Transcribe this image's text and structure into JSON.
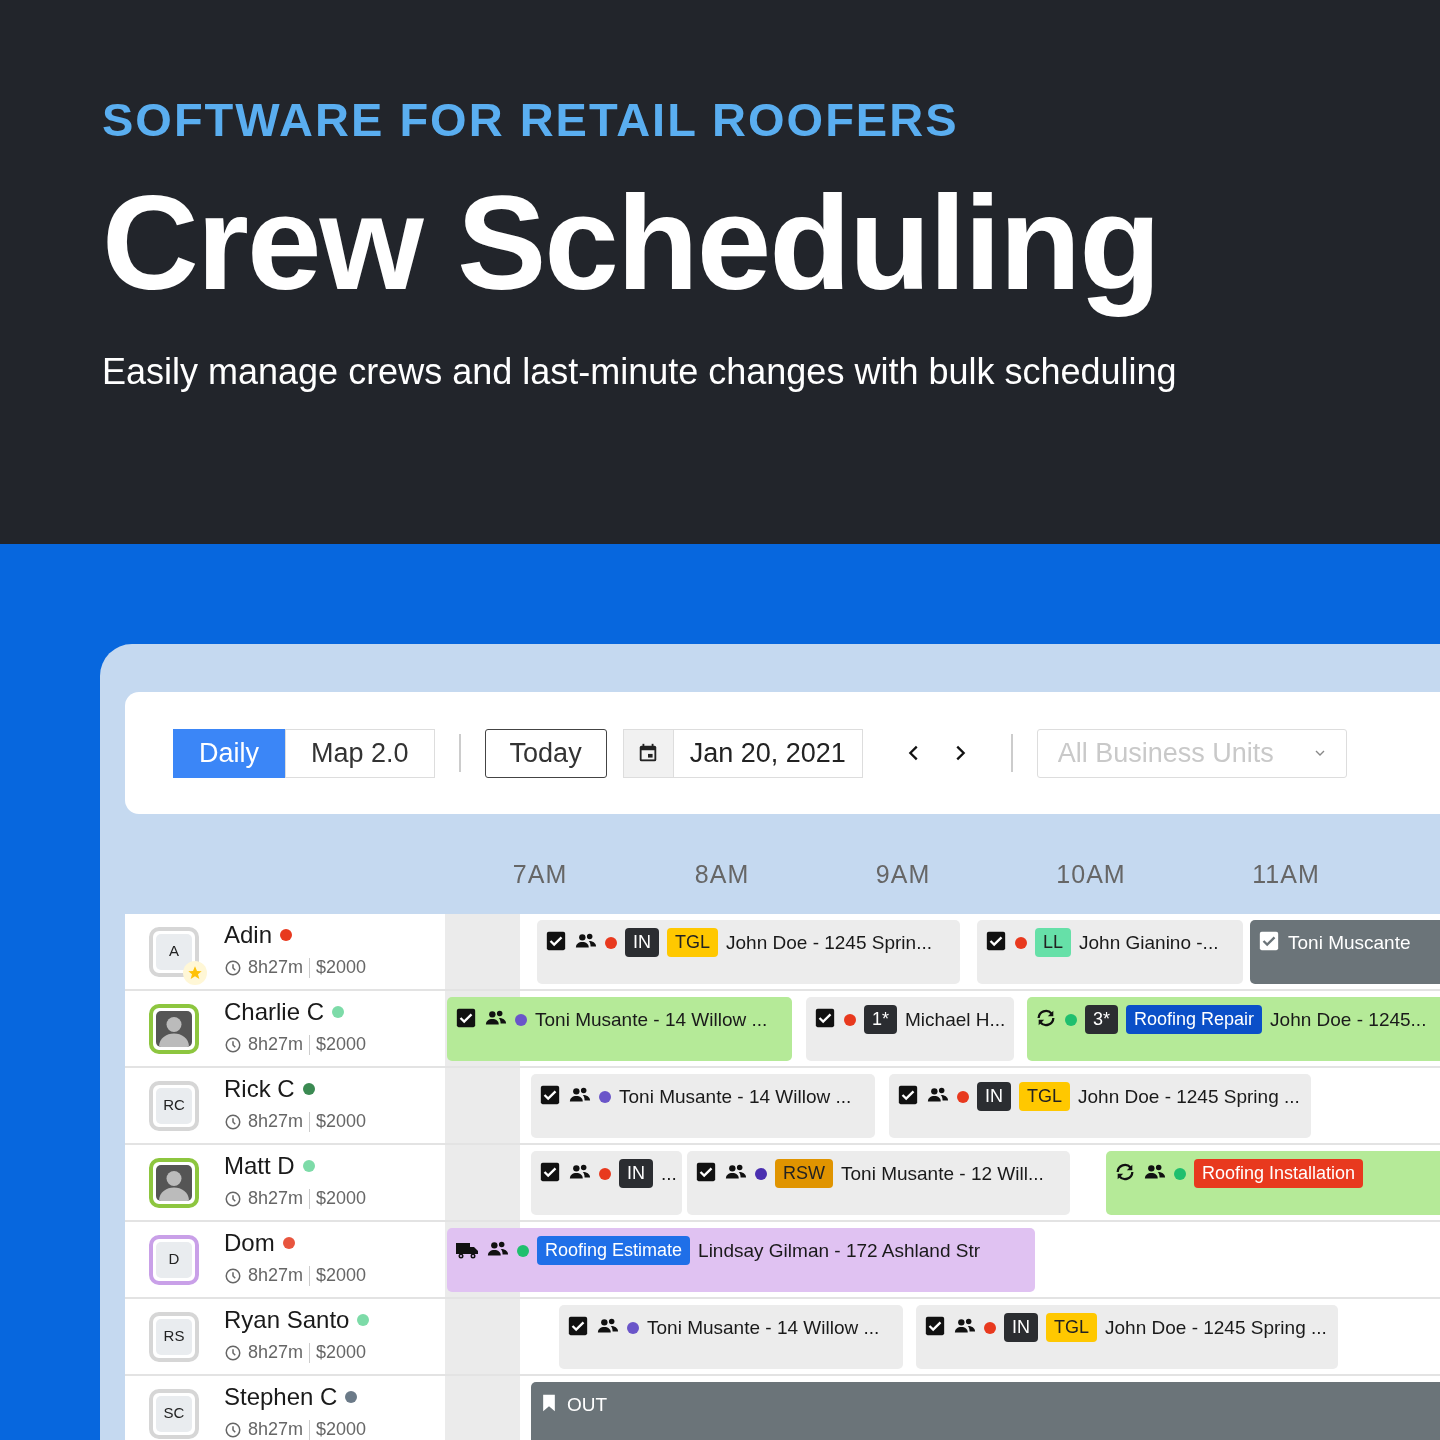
{
  "header": {
    "eyebrow": "SOFTWARE FOR RETAIL ROOFERS",
    "title": "Crew Scheduling",
    "subtitle": "Easily manage crews and last-minute changes with bulk scheduling"
  },
  "toolbar": {
    "views": [
      {
        "label": "Daily",
        "selected": true
      },
      {
        "label": "Map 2.0",
        "selected": false
      }
    ],
    "today_button": "Today",
    "date": "Jan 20, 2021",
    "business_units": {
      "placeholder": "All Business Units"
    }
  },
  "hours": [
    "7AM",
    "8AM",
    "9AM",
    "10AM",
    "11AM"
  ],
  "crew": [
    {
      "avatar": {
        "kind": "initials",
        "initials": "A",
        "color": "#d6d6d6"
      },
      "starred": true,
      "name": "Adin",
      "color": "#e8391e",
      "hours": "8h27m",
      "amount": "$2000",
      "events": [
        {
          "kind": "job",
          "color": "#ececec",
          "checked": true,
          "crew": true,
          "dot": {
            "color": "#e8391e"
          },
          "tags": [
            {
              "text": "IN",
              "color": "#2b2d31"
            },
            {
              "text": "TGL",
              "color": "#ffc800"
            }
          ],
          "text": "John Doe - 1245 Sprin..."
        },
        {
          "kind": "job",
          "color": "#ececec",
          "checked": true,
          "dot": {
            "color": "#e8391e"
          },
          "tags": [
            {
              "text": "LL",
              "color": "#66e0a8"
            }
          ],
          "text": "John Gianino -..."
        },
        {
          "kind": "blocked",
          "color": "#6b7479",
          "checked": true,
          "text": "Toni Muscante"
        }
      ]
    },
    {
      "avatar": {
        "kind": "photo",
        "color": "#8dc63f"
      },
      "starred": false,
      "name": "Charlie C",
      "color": "#7ddba8",
      "hours": "8h27m",
      "amount": "$2000",
      "events": [
        {
          "kind": "job",
          "color": "#b5ea98",
          "checked": true,
          "crew": true,
          "dot": {
            "color": "#6a55c9"
          },
          "text": "Toni Musante - 14 Willow ..."
        },
        {
          "kind": "job",
          "color": "#ececec",
          "checked": true,
          "dot": {
            "color": "#e8391e"
          },
          "tags": [
            {
              "text": "1*",
              "color": "#2b2d31"
            }
          ],
          "text": "Michael H..."
        },
        {
          "kind": "job",
          "color": "#b5ea98",
          "sync": true,
          "dot": {
            "color": "#1fbf6e"
          },
          "tags": [
            {
              "text": "3*",
              "color": "#2b2d31"
            },
            {
              "text": "Roofing Repair",
              "color": "#0a4fc8"
            }
          ],
          "text": "John Doe - 1245..."
        }
      ]
    },
    {
      "avatar": {
        "kind": "initials",
        "initials": "RC",
        "color": "#d6d6d6"
      },
      "starred": false,
      "name": "Rick C",
      "color": "#3b8a52",
      "hours": "8h27m",
      "amount": "$2000",
      "events": [
        {
          "kind": "job",
          "color": "#ececec",
          "checked": true,
          "crew": true,
          "dot": {
            "color": "#6a55c9"
          },
          "text": "Toni Musante - 14 Willow ..."
        },
        {
          "kind": "job",
          "color": "#ececec",
          "checked": true,
          "crew": true,
          "dot": {
            "color": "#e8391e"
          },
          "tags": [
            {
              "text": "IN",
              "color": "#2b2d31"
            },
            {
              "text": "TGL",
              "color": "#ffc800"
            }
          ],
          "text": "John Doe - 1245 Spring ..."
        }
      ]
    },
    {
      "avatar": {
        "kind": "photo",
        "color": "#8dc63f"
      },
      "starred": false,
      "name": "Matt D",
      "color": "#7ddba8",
      "hours": "8h27m",
      "amount": "$2000",
      "events": [
        {
          "kind": "job",
          "color": "#ececec",
          "checked": true,
          "crew": true,
          "dot": {
            "color": "#e8391e"
          },
          "tags": [
            {
              "text": "IN",
              "color": "#2b2d31"
            }
          ],
          "text": "..."
        },
        {
          "kind": "job",
          "color": "#ececec",
          "checked": true,
          "crew": true,
          "dot": {
            "color": "#4a2fb0"
          },
          "tags": [
            {
              "text": "RSW",
              "color": "#e09400"
            }
          ],
          "text": "Toni Musante - 12 Will..."
        },
        {
          "kind": "job",
          "color": "#b5ea98",
          "sync": true,
          "crew": true,
          "dot": {
            "color": "#1fbf6e"
          },
          "tags": [
            {
              "text": "Roofing Installation",
              "color": "#e8391e"
            }
          ]
        }
      ]
    },
    {
      "avatar": {
        "kind": "initials",
        "initials": "D",
        "color": "#c9a0e8"
      },
      "starred": false,
      "name": "Dom",
      "color": "#e8553e",
      "hours": "8h27m",
      "amount": "$2000",
      "events": [
        {
          "kind": "job",
          "color": "#e0c2f2",
          "truck": true,
          "crew": true,
          "dot": {
            "color": "#1fbf6e"
          },
          "tags": [
            {
              "text": "Roofing Estimate",
              "color": "#1f6fe8"
            }
          ],
          "text": "Lindsay Gilman - 172 Ashland Str"
        }
      ]
    },
    {
      "avatar": {
        "kind": "initials",
        "initials": "RS",
        "color": "#d6d6d6"
      },
      "starred": false,
      "name": "Ryan Santo",
      "color": "#7ddba8",
      "hours": "8h27m",
      "amount": "$2000",
      "events": [
        {
          "kind": "job",
          "color": "#ececec",
          "checked": true,
          "crew": true,
          "dot": {
            "color": "#6a55c9"
          },
          "text": "Toni Musante - 14 Willow ..."
        },
        {
          "kind": "job",
          "color": "#ececec",
          "checked": true,
          "crew": true,
          "dot": {
            "color": "#e8391e"
          },
          "tags": [
            {
              "text": "IN",
              "color": "#2b2d31"
            },
            {
              "text": "TGL",
              "color": "#ffc800"
            }
          ],
          "text": "John Doe - 1245 Spring ..."
        }
      ]
    },
    {
      "avatar": {
        "kind": "initials",
        "initials": "SC",
        "color": "#d6d6d6"
      },
      "starred": false,
      "name": "Stephen C",
      "color": "#6b7a88",
      "hours": "8h27m",
      "amount": "$2000",
      "events": [
        {
          "kind": "blocked",
          "color": "#6b7479",
          "bookmark": true,
          "text": "OUT"
        }
      ]
    }
  ]
}
